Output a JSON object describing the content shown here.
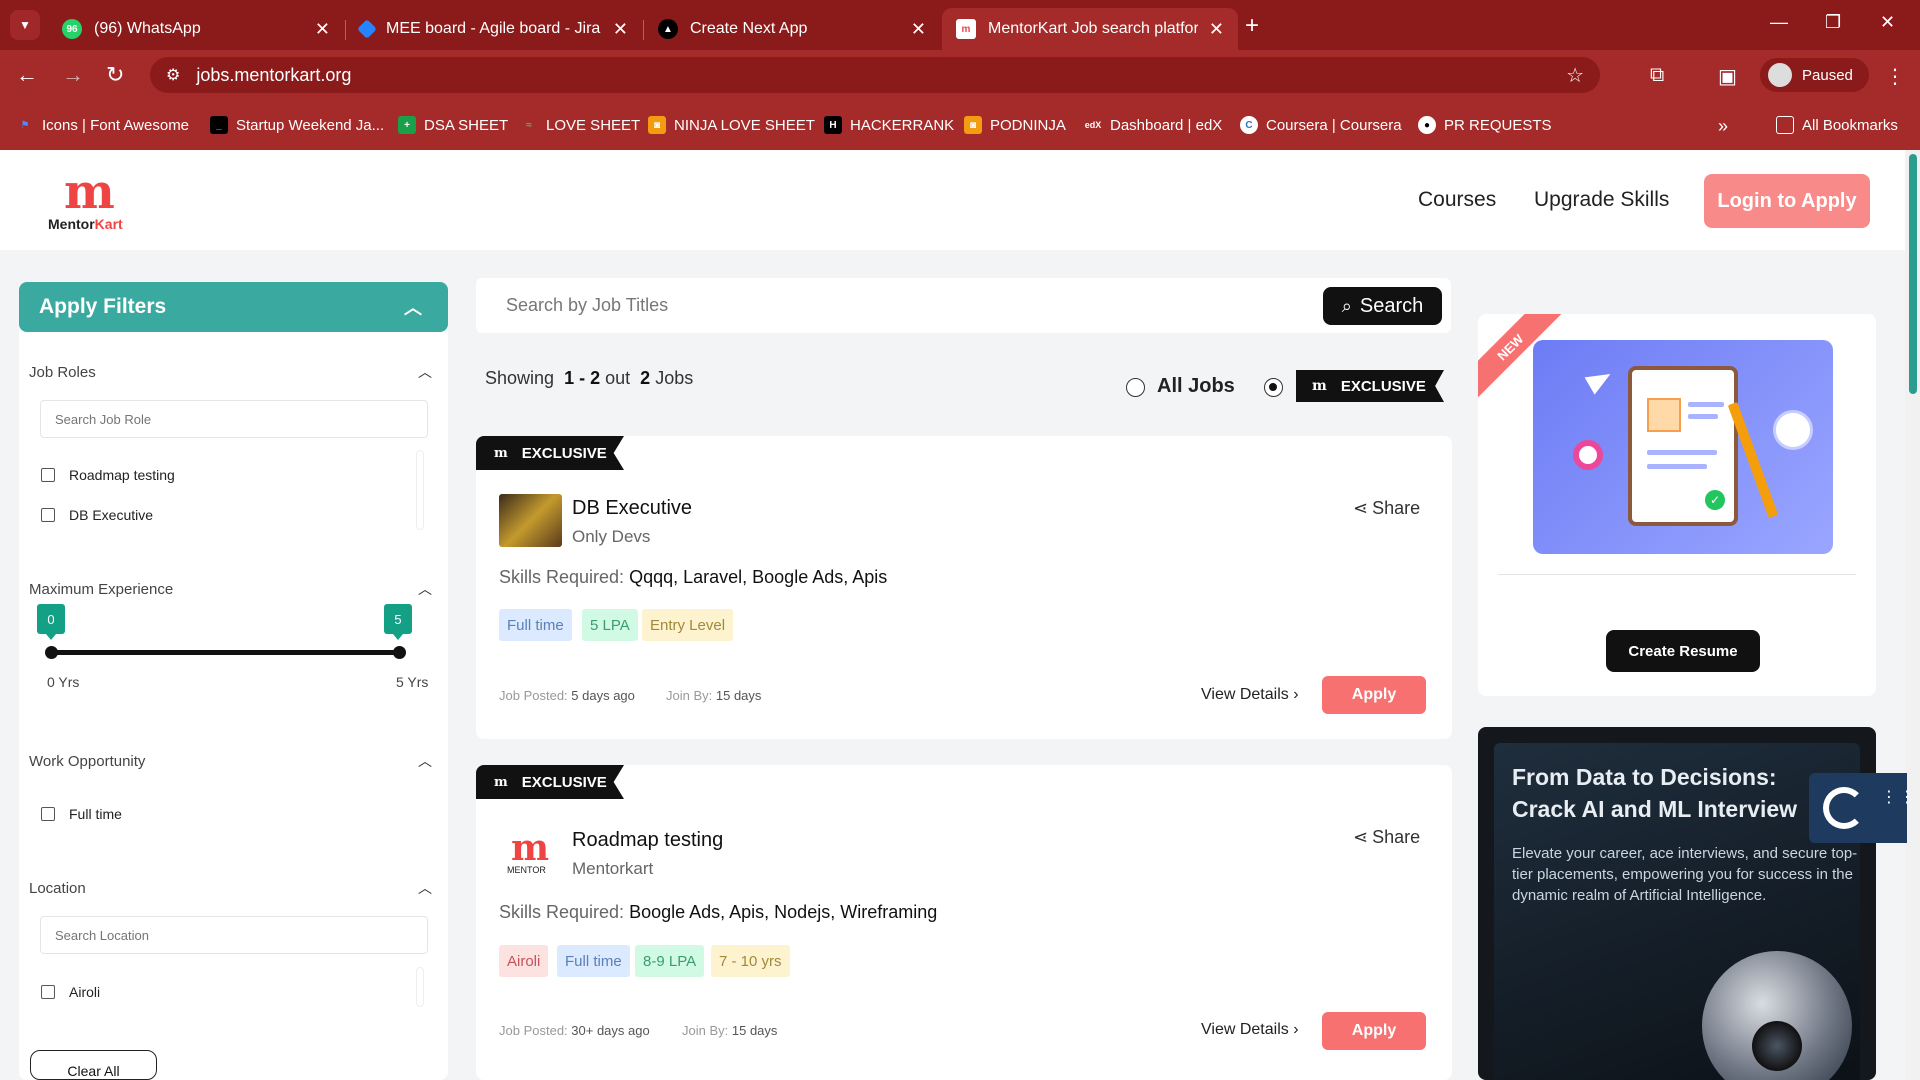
{
  "browser": {
    "tabs": [
      {
        "title": "(96) WhatsApp",
        "icon": "whatsapp-icon",
        "badge": "96"
      },
      {
        "title": "MEE board - Agile board - Jira",
        "icon": "jira-icon"
      },
      {
        "title": "Create Next App",
        "icon": "nextjs-icon"
      },
      {
        "title": "MentorKart Job search platform",
        "icon": "mentorkart-icon",
        "active": true
      }
    ],
    "url": "jobs.mentorkart.org",
    "profile_label": "Paused",
    "bookmarks": [
      {
        "label": "Icons | Font Awesome",
        "icon": "flag-icon"
      },
      {
        "label": "Startup Weekend Ja...",
        "icon": "startup-icon"
      },
      {
        "label": "DSA SHEET",
        "icon": "plus-sheet-icon"
      },
      {
        "label": "LOVE SHEET",
        "icon": "love-sheet-icon"
      },
      {
        "label": "NINJA LOVE SHEET",
        "icon": "codingninjas-icon"
      },
      {
        "label": "HACKERRANK",
        "icon": "hackerrank-icon"
      },
      {
        "label": "PODNINJA",
        "icon": "codingninjas-icon"
      },
      {
        "label": "Dashboard | edX",
        "icon": "edx-icon"
      },
      {
        "label": "Coursera | Coursera",
        "icon": "coursera-icon"
      },
      {
        "label": "PR REQUESTS",
        "icon": "github-icon"
      }
    ],
    "all_bookmarks": "All Bookmarks"
  },
  "header": {
    "logo_mark": "m",
    "logo_word_a": "Mentor",
    "logo_word_b": "Kart",
    "nav": [
      "Courses",
      "Upgrade Skills"
    ],
    "login_label": "Login to Apply"
  },
  "filters": {
    "title": "Apply Filters",
    "job_roles": {
      "title": "Job Roles",
      "placeholder": "Search Job Role",
      "options": [
        "Roadmap testing",
        "DB Executive"
      ]
    },
    "experience": {
      "title": "Maximum Experience",
      "min": 0,
      "max": 5,
      "min_tip": "0",
      "max_tip": "5",
      "min_label": "0 Yrs",
      "max_label": "5 Yrs"
    },
    "work_opportunity": {
      "title": "Work Opportunity",
      "options": [
        "Full time"
      ]
    },
    "location": {
      "title": "Location",
      "placeholder": "Search Location",
      "options": [
        "Airoli"
      ]
    },
    "clear_label": "Clear All"
  },
  "search": {
    "placeholder": "Search by Job Titles",
    "button_label": "Search"
  },
  "results": {
    "showing": "Showing",
    "range": "1 - 2",
    "out": "out",
    "count": "2",
    "jobs": "Jobs",
    "all_jobs_label": "All Jobs",
    "exclusive_label": "EXCLUSIVE"
  },
  "jobs": [
    {
      "badge": "EXCLUSIVE",
      "title": "DB Executive",
      "company": "Only Devs",
      "skills_label": "Skills Required:",
      "skills": "Qqqq, Laravel, Boogle Ads, Apis",
      "tags": [
        "Full time",
        "5 LPA",
        "Entry Level"
      ],
      "posted_label": "Job Posted:",
      "posted": "5 days ago",
      "join_label": "Join By:",
      "join": "15 days",
      "share": "Share",
      "view": "View Details",
      "apply": "Apply"
    },
    {
      "badge": "EXCLUSIVE",
      "title": "Roadmap testing",
      "company": "Mentorkart",
      "logo_text": "MENTOR",
      "skills_label": "Skills Required:",
      "skills": "Boogle Ads, Apis, Nodejs, Wireframing",
      "tags": [
        "Airoli",
        "Full time",
        "8-9 LPA",
        "7 - 10 yrs"
      ],
      "posted_label": "Job Posted:",
      "posted": "30+ days ago",
      "join_label": "Join By:",
      "join": "15 days",
      "share": "Share",
      "view": "View Details",
      "apply": "Apply"
    }
  ],
  "sidebar_right": {
    "new_ribbon": "NEW",
    "resume_button": "Create Resume",
    "ai_title_1": "From Data to Decisions:",
    "ai_title_2": "Crack AI and ML Interview",
    "ai_body": "Elevate your career, ace interviews, and secure top-tier placements, empowering you for success in the dynamic realm of Artificial Intelligence."
  },
  "colors": {
    "chrome": "#a52a2a",
    "teal": "#3aa99f",
    "accent": "#f87171",
    "login": "#f98a8a"
  }
}
